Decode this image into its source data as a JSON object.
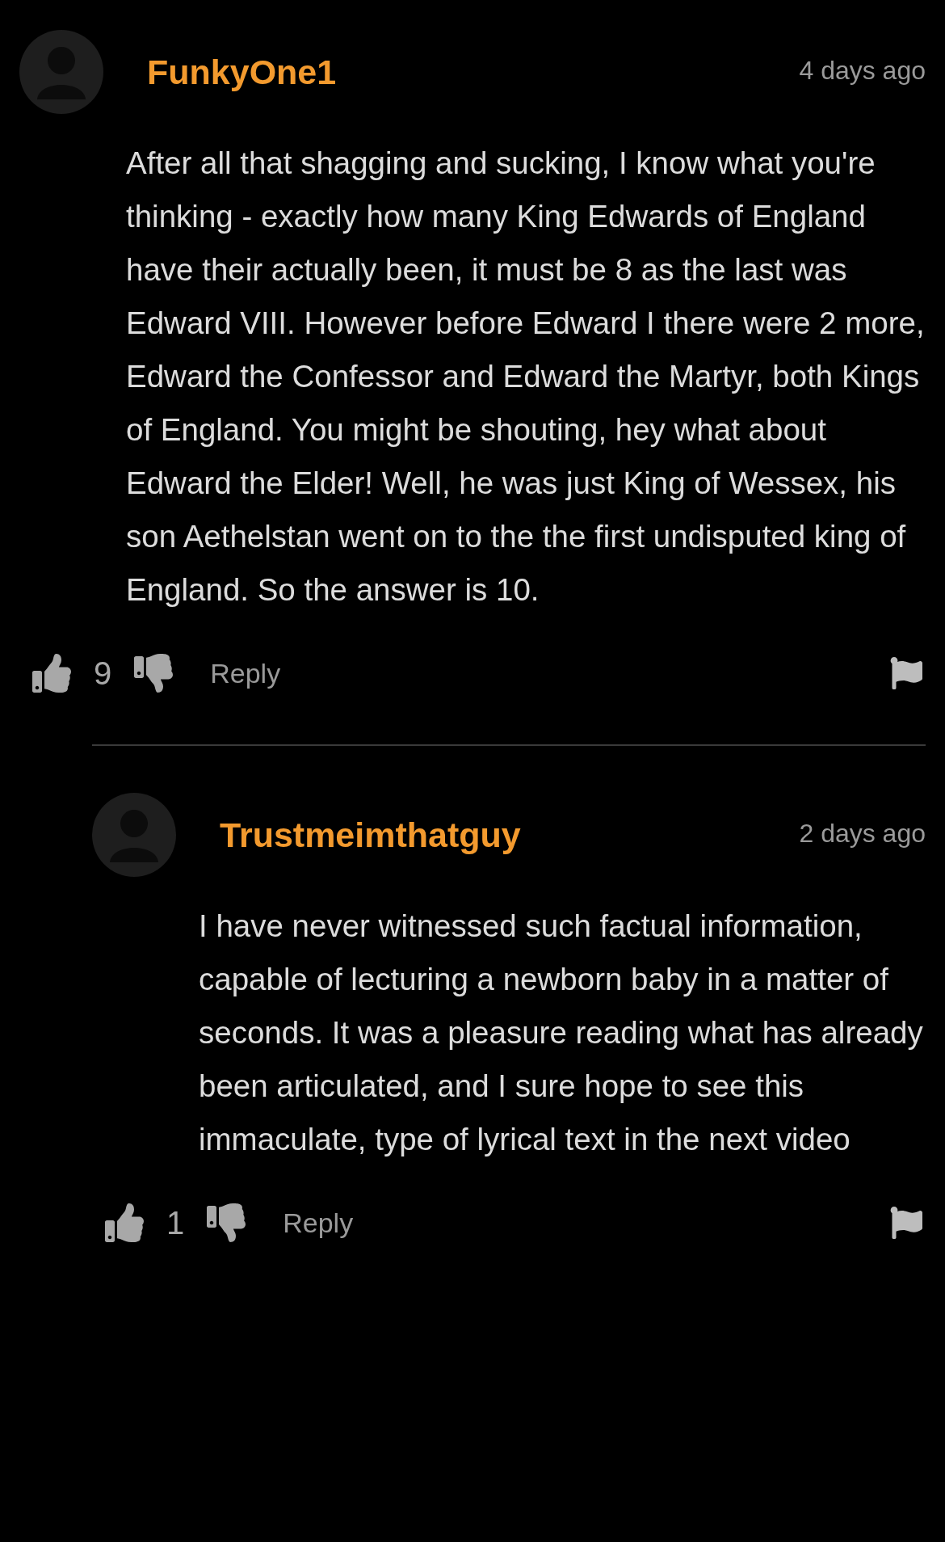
{
  "comments": [
    {
      "kind": "top",
      "author": "FunkyOne1",
      "time": "4 days ago",
      "text": "After all that shagging and sucking, I know what you're thinking - exactly how many King Edwards of England have their actually been, it must be 8 as the last was Edward VIII. However before Edward I there were 2 more, Edward the Confessor and Edward the Martyr, both Kings of England. You might be shouting, hey what about Edward the Elder! Well, he was just King of Wessex, his son Aethelstan went on to the the first undisputed king of England. So the answer is 10.",
      "likes": "9",
      "reply": "Reply"
    },
    {
      "kind": "reply",
      "author": "Trustmeimthatguy",
      "time": "2 days ago",
      "text": "I have never witnessed such factual information, capable of lecturing a newborn baby in a matter of seconds. It was a pleasure reading what has already been articulated, and I sure hope to see this immaculate, type of lyrical text in the next video",
      "likes": "1",
      "reply": "Reply"
    }
  ]
}
